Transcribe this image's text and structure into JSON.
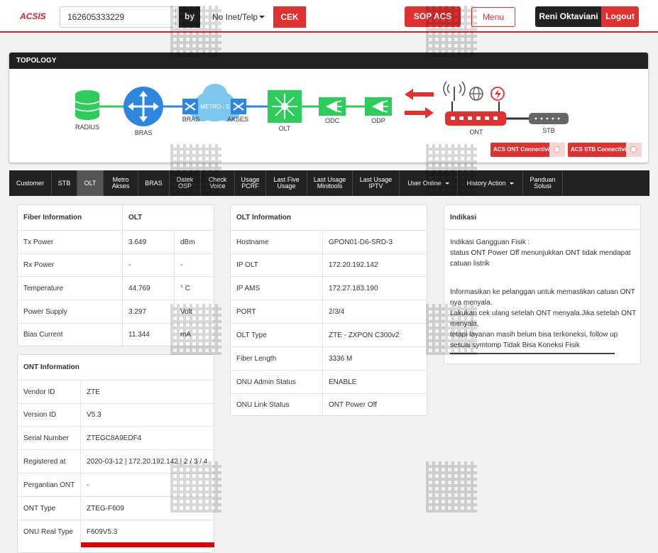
{
  "header": {
    "logo": "ACSIS",
    "search_value": "162605333229",
    "by_label": "by",
    "search_type": "No Inet/Telp",
    "cek_label": "CEK",
    "sop_label": "SOP ACS",
    "menu_label": "Menu",
    "user_name": "Reni Oktaviani",
    "logout_label": "Logout"
  },
  "topology": {
    "title": "TOPOLOGY",
    "nodes": {
      "radius": "RADIUS",
      "bras": "BRAS",
      "bras2": "BRAS",
      "metro": "METRO - E",
      "akses": "AKSES",
      "olt": "OLT",
      "odc": "ODC",
      "odp": "ODP",
      "ont": "ONT",
      "stb": "STB"
    },
    "ont_connectivity_label": "ACS ONT Connectivity",
    "stb_connectivity_label": "ACS STB Connectivity",
    "colors": {
      "green": "#2ecc5a",
      "blue": "#2e86de",
      "red": "#e03131",
      "cloud": "#7ec8f0"
    }
  },
  "nav": {
    "items": [
      {
        "label": "Customer",
        "label2": ""
      },
      {
        "label": "STB",
        "label2": ""
      },
      {
        "label": "OLT",
        "label2": ""
      },
      {
        "label": "Metro",
        "label2": "Akses"
      },
      {
        "label": "BRAS",
        "label2": ""
      },
      {
        "label": "Datek",
        "label2": "OSP"
      },
      {
        "label": "Check",
        "label2": "Voice"
      },
      {
        "label": "Usage",
        "label2": "PCRF"
      },
      {
        "label": "Last Five",
        "label2": "Usage"
      },
      {
        "label": "Last Usage",
        "label2": "Minitools"
      },
      {
        "label": "Last Usage",
        "label2": "IPTV"
      },
      {
        "label": "User Online",
        "label2": ""
      },
      {
        "label": "History Action",
        "label2": ""
      },
      {
        "label": "Panduan",
        "label2": "Solusi"
      }
    ],
    "active": "OLT"
  },
  "fiber": {
    "header": "Fiber Information",
    "header_value": "OLT",
    "rows": [
      {
        "label": "Tx Power",
        "value": "3.649",
        "unit": "dBm"
      },
      {
        "label": "Rx Power",
        "value": "-",
        "unit": "-"
      },
      {
        "label": "Temperature",
        "value": "44.769",
        "unit": "° C"
      },
      {
        "label": "Power Supply",
        "value": "3.297",
        "unit": "Volt"
      },
      {
        "label": "Bias Current",
        "value": "11.344",
        "unit": "mA"
      }
    ]
  },
  "ont": {
    "header": "ONT Information",
    "rows": [
      {
        "label": "Vendor ID",
        "value": "ZTE"
      },
      {
        "label": "Version ID",
        "value": "V5.3"
      },
      {
        "label": "Serial Number",
        "value": "ZTEGC8A9EDF4"
      },
      {
        "label": "Registered at",
        "value": "2020-03-12 | 172.20.192.142 | 2 / 3 / 4"
      },
      {
        "label": "Pergantian ONT",
        "value": "-"
      },
      {
        "label": "ONT Type",
        "value": "ZTEG-F609"
      },
      {
        "label": "ONU Real Type",
        "value": "F609V5.3"
      }
    ]
  },
  "olt": {
    "header": "OLT Information",
    "rows": [
      {
        "label": "Hostname",
        "value": "GPON01-D6-SRD-3"
      },
      {
        "label": "IP OLT",
        "value": "172.20.192.142"
      },
      {
        "label": "IP AMS",
        "value": "172.27.183.190"
      },
      {
        "label": "PORT",
        "value": "2/3/4"
      },
      {
        "label": "OLT Type",
        "value": "ZTE - ZXPON C300v2"
      },
      {
        "label": "Fiber Length",
        "value": "3336 M"
      },
      {
        "label": "ONU Admin Status",
        "value": "ENABLE"
      },
      {
        "label": "ONU Link Status",
        "value": "ONT Power Off"
      }
    ]
  },
  "indikasi": {
    "header": "Indikasi",
    "line1": "Indikasi Gangguan Fisik :",
    "line2": "status ONT Power Off menunjukkan ONT tidak mendapat catuan listrik",
    "line3": "Informasikan ke pelanggan untuk memastikan catuan ONT nya menyala.",
    "line4": "Lakukan cek ulang setelah ONT menyala.Jika setelah ONT menyala,",
    "line5": "tetapi layanan masih belum bisa terkoneksi, follow up sesuai symtomp Tidak Bisa Koneksi Fisik"
  }
}
